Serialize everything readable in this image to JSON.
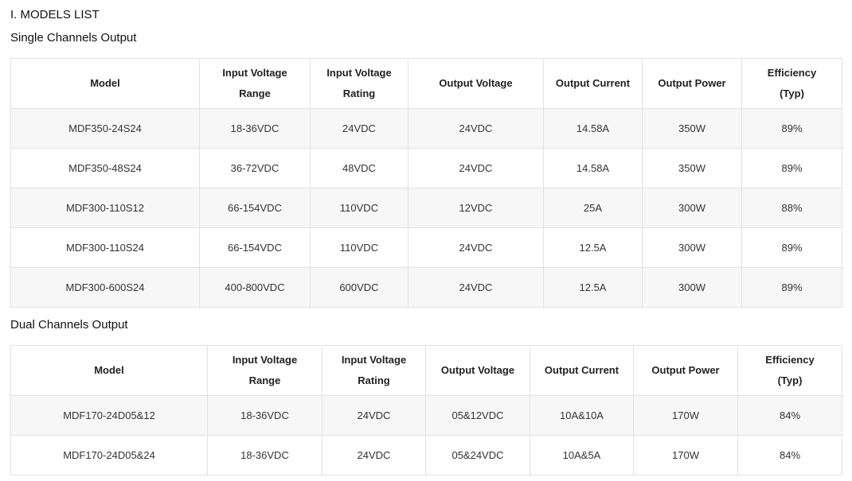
{
  "section_title": "I. MODELS LIST",
  "single": {
    "title": "Single Channels Output",
    "headers": [
      [
        "Model"
      ],
      [
        "Input Voltage",
        "Range"
      ],
      [
        "Input Voltage",
        "Rating"
      ],
      [
        "Output Voltage"
      ],
      [
        "Output Current"
      ],
      [
        "Output Power"
      ],
      [
        "Efficiency",
        "(Typ)"
      ]
    ],
    "rows": [
      [
        "MDF350-24S24",
        "18-36VDC",
        "24VDC",
        "24VDC",
        "14.58A",
        "350W",
        "89%"
      ],
      [
        "MDF350-48S24",
        "36-72VDC",
        "48VDC",
        "24VDC",
        "14.58A",
        "350W",
        "89%"
      ],
      [
        "MDF300-110S12",
        "66-154VDC",
        "110VDC",
        "12VDC",
        "25A",
        "300W",
        "88%"
      ],
      [
        "MDF300-110S24",
        "66-154VDC",
        "110VDC",
        "24VDC",
        "12.5A",
        "300W",
        "89%"
      ],
      [
        "MDF300-600S24",
        "400-800VDC",
        "600VDC",
        "24VDC",
        "12.5A",
        "300W",
        "89%"
      ]
    ]
  },
  "dual": {
    "title": "Dual Channels Output",
    "headers": [
      [
        "Model"
      ],
      [
        "Input Voltage",
        "Range"
      ],
      [
        "Input Voltage",
        "Rating"
      ],
      [
        "Output Voltage"
      ],
      [
        "Output Current"
      ],
      [
        "Output Power"
      ],
      [
        "Efficiency",
        "(Typ)"
      ]
    ],
    "rows": [
      [
        "MDF170-24D05&12",
        "18-36VDC",
        "24VDC",
        "05&12VDC",
        "10A&10A",
        "170W",
        "84%"
      ],
      [
        "MDF170-24D05&24",
        "18-36VDC",
        "24VDC",
        "05&24VDC",
        "10A&5A",
        "170W",
        "84%"
      ]
    ]
  }
}
